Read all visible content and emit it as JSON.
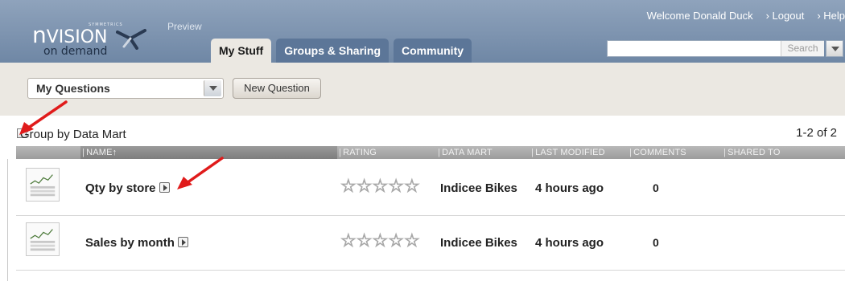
{
  "header": {
    "logo": {
      "symmetrics": "SYMMETRICS",
      "n": "n",
      "vision": "VISION",
      "sub": "on demand"
    },
    "preview": "Preview",
    "tabs": [
      {
        "label": "My Stuff",
        "active": true
      },
      {
        "label": "Groups & Sharing",
        "active": false
      },
      {
        "label": "Community",
        "active": false
      }
    ],
    "welcome": "Welcome Donald Duck",
    "logout": "› Logout",
    "help": "› Help",
    "search_placeholder": "",
    "search_button": "Search"
  },
  "toolbar": {
    "selected_view": "My Questions",
    "new_question": "New Question"
  },
  "groupbar": {
    "label": "Group by Data Mart",
    "count": "1-2 of 2"
  },
  "columns": {
    "name": "NAME↑",
    "rating": "RATING",
    "data_mart": "DATA MART",
    "last_modified": "LAST MODIFIED",
    "comments": "COMMENTS",
    "shared_to": "SHARED TO"
  },
  "rows": [
    {
      "name": "Qty by store",
      "rating": 0,
      "data_mart": "Indicee Bikes",
      "last_modified": "4 hours ago",
      "comments": "0",
      "shared_to": ""
    },
    {
      "name": "Sales by month",
      "rating": 0,
      "data_mart": "Indicee Bikes",
      "last_modified": "4 hours ago",
      "comments": "0",
      "shared_to": ""
    }
  ],
  "icons": {
    "star": "☆",
    "thumbnail": "chart-thumbnail-icon",
    "run": "play-icon",
    "annotation": "red-arrow-icon"
  },
  "colors": {
    "header": "#7d93ae",
    "tab_inactive": "#5c7698",
    "toolbar_bg": "#ebe8e2",
    "annotation_red": "#e01b1b"
  }
}
